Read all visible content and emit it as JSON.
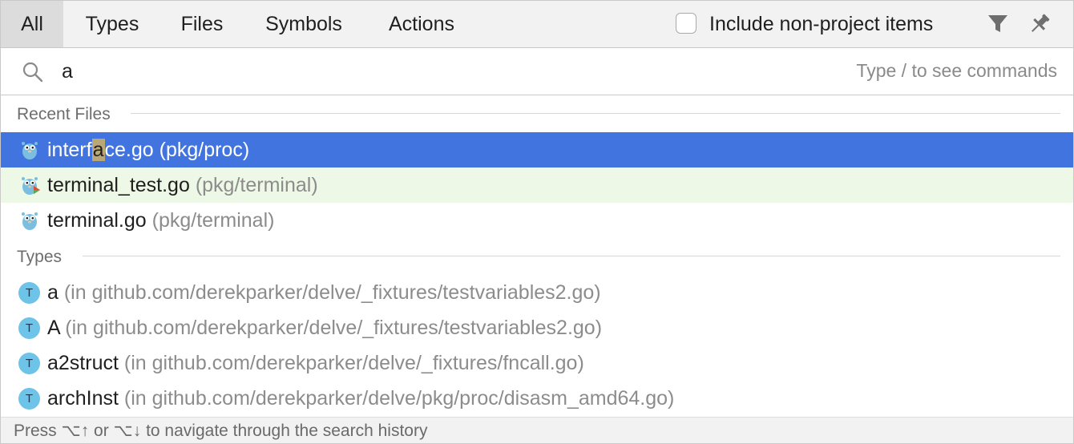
{
  "tabs": [
    "All",
    "Types",
    "Files",
    "Symbols",
    "Actions"
  ],
  "include_non_project_label": "Include non-project items",
  "search": {
    "value": "a",
    "hint": "Type / to see commands"
  },
  "sections": {
    "recent_files": {
      "title": "Recent Files",
      "items": [
        {
          "name_before": "interf",
          "name_match": "a",
          "name_after": "ce.go",
          "location": "(pkg/proc)"
        },
        {
          "name": "terminal_test.go",
          "location": "(pkg/terminal)"
        },
        {
          "name": "terminal.go",
          "location": "(pkg/terminal)"
        }
      ]
    },
    "types": {
      "title": "Types",
      "badge": "T",
      "items": [
        {
          "name": "a",
          "location": "(in github.com/derekparker/delve/_fixtures/testvariables2.go)"
        },
        {
          "name": "A",
          "location": "(in github.com/derekparker/delve/_fixtures/testvariables2.go)"
        },
        {
          "name": "a2struct",
          "location": "(in github.com/derekparker/delve/_fixtures/fncall.go)"
        },
        {
          "name": "archInst",
          "location": "(in github.com/derekparker/delve/pkg/proc/disasm_amd64.go)"
        }
      ]
    }
  },
  "footer": "Press ⌥↑ or ⌥↓ to navigate through the search history",
  "colors": {
    "selection": "#4274e0",
    "test_row": "#eef8e6",
    "type_badge": "#6ec3e8",
    "match_highlight": "#b9a876"
  },
  "icons": {
    "file": "gopher-icon",
    "test_file": "gopher-test-icon",
    "filter": "filter-icon",
    "pin": "pin-icon",
    "search": "search-icon"
  }
}
